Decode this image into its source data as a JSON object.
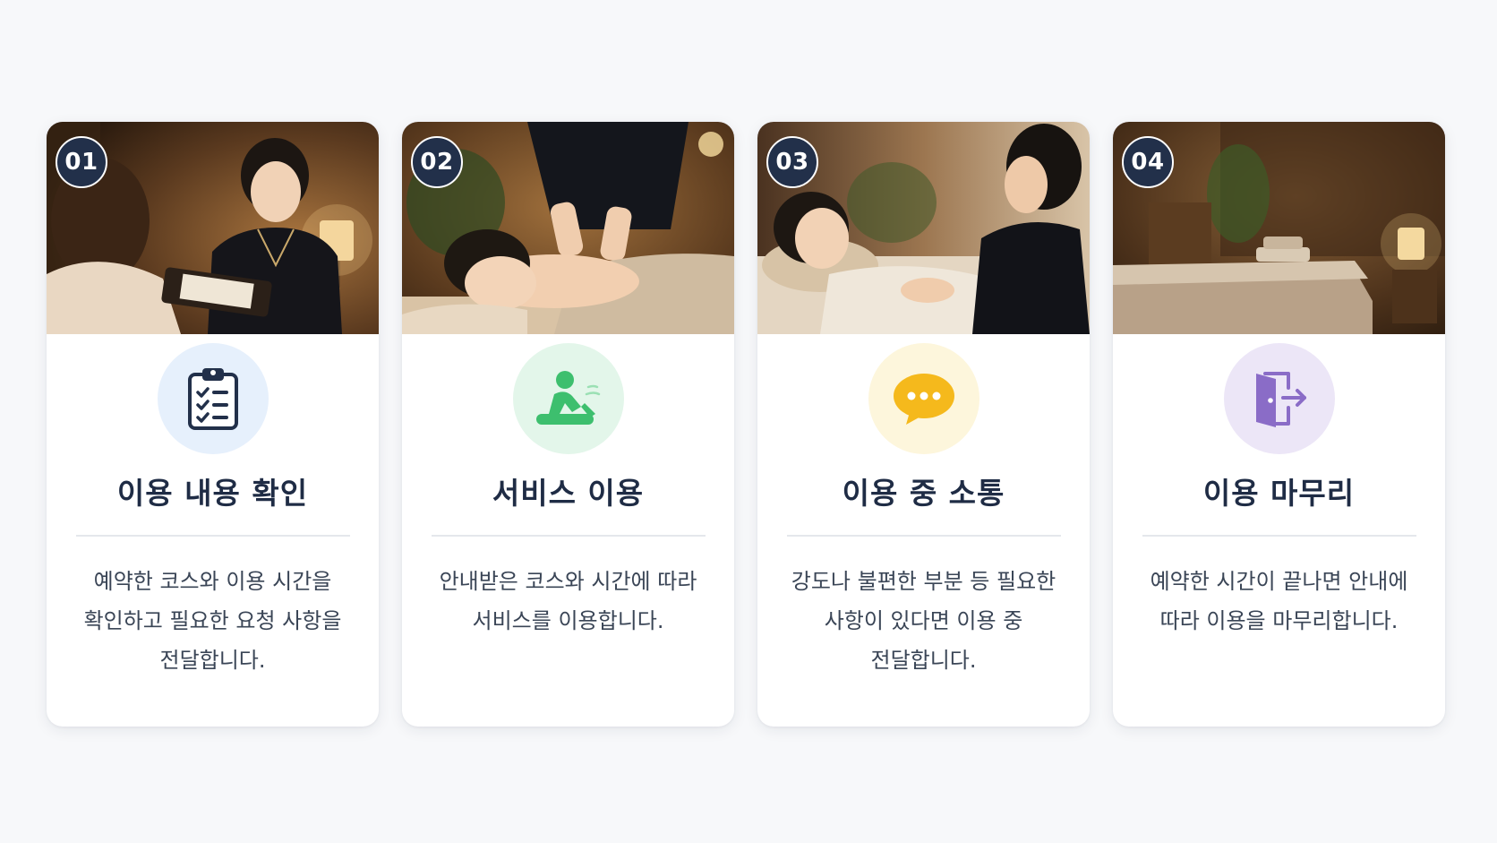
{
  "steps": [
    {
      "number": "01",
      "title": "이용 내용 확인",
      "description": "예약한 코스와 이용 시간을 확인하고 필요한 요청 사항을 전달합니다.",
      "icon": "clipboard-checklist-icon",
      "icon_bg": "#e6f0fc",
      "icon_color": "#22304a"
    },
    {
      "number": "02",
      "title": "서비스 이용",
      "description": "안내받은 코스와 시간에 따라 서비스를 이용합니다.",
      "icon": "massage-person-icon",
      "icon_bg": "#e3f6ea",
      "icon_color": "#3dbf6e"
    },
    {
      "number": "03",
      "title": "이용 중 소통",
      "description": "강도나 불편한 부분 등 필요한 사항이 있다면 이용 중 전달합니다.",
      "icon": "chat-bubble-icon",
      "icon_bg": "#fdf6dc",
      "icon_color": "#f5b91c"
    },
    {
      "number": "04",
      "title": "이용 마무리",
      "description": "예약한 시간이 끝나면 안내에 따라 이용을 마무리합니다.",
      "icon": "exit-door-icon",
      "icon_bg": "#ece6f7",
      "icon_color": "#8a6cc7"
    }
  ],
  "colors": {
    "badge_bg": "#22304a",
    "title": "#1f2c45",
    "text": "#3a4556",
    "page_bg": "#f7f8fa"
  }
}
